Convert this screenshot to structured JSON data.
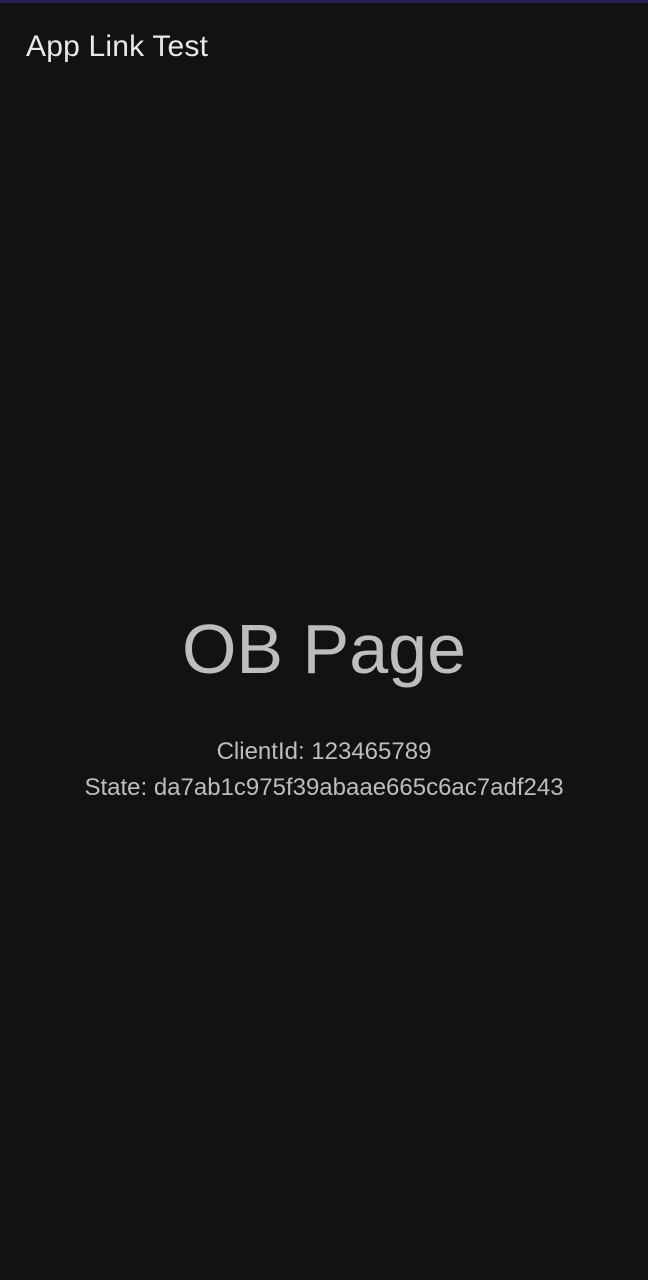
{
  "app_bar": {
    "title": "App Link Test"
  },
  "main": {
    "heading": "OB Page",
    "client_line": "ClientId: 123465789",
    "state_line": "State: da7ab1c975f39abaae665c6ac7adf243"
  },
  "colors": {
    "background": "#121212",
    "status_strip": "#2a1f52",
    "title_text": "#e8e8e8",
    "body_text": "#bdbdbd"
  }
}
